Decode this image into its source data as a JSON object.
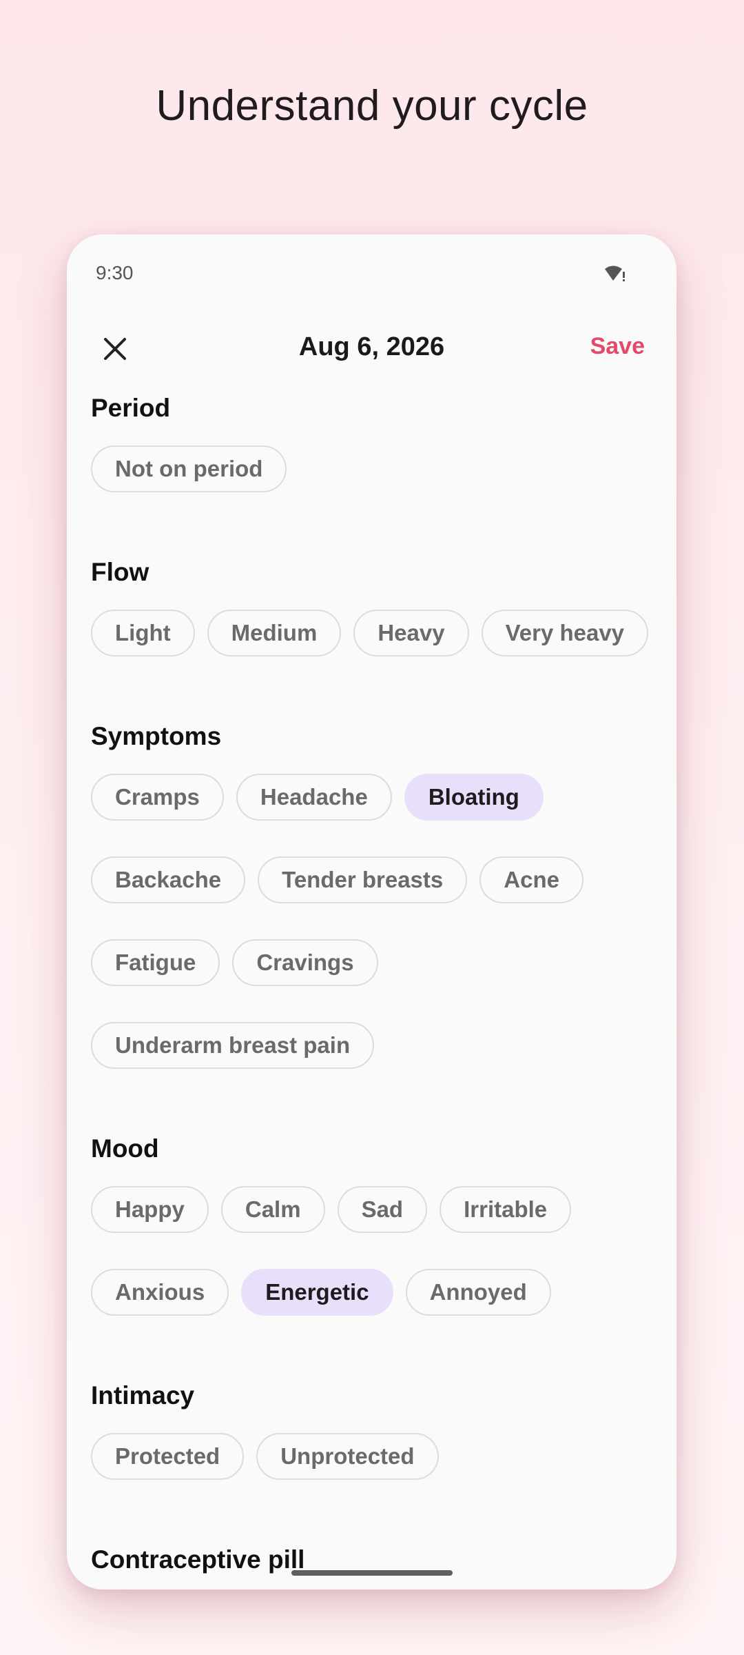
{
  "promo": {
    "title": "Understand your cycle"
  },
  "status": {
    "time": "9:30",
    "signal_icon": "wifi-alert-icon"
  },
  "header": {
    "date": "Aug 6, 2026",
    "save_label": "Save",
    "close_icon": "close-icon"
  },
  "colors": {
    "accent": "#e2496b",
    "selected_chip": "#e8dffa",
    "background": "#fde7ea"
  },
  "sections": {
    "period": {
      "title": "Period",
      "chips": [
        "Not on period"
      ]
    },
    "flow": {
      "title": "Flow",
      "chips": [
        "Light",
        "Medium",
        "Heavy",
        "Very heavy"
      ]
    },
    "symptoms": {
      "title": "Symptoms",
      "chips": [
        "Cramps",
        "Headache",
        "Bloating",
        "Backache",
        "Tender breasts",
        "Acne",
        "Fatigue",
        "Cravings",
        "Underarm breast pain"
      ],
      "selected": [
        "Bloating"
      ]
    },
    "mood": {
      "title": "Mood",
      "chips": [
        "Happy",
        "Calm",
        "Sad",
        "Irritable",
        "Anxious",
        "Energetic",
        "Annoyed"
      ],
      "selected": [
        "Energetic"
      ]
    },
    "intimacy": {
      "title": "Intimacy",
      "chips": [
        "Protected",
        "Unprotected"
      ]
    },
    "pill": {
      "title": "Contraceptive pill"
    }
  }
}
